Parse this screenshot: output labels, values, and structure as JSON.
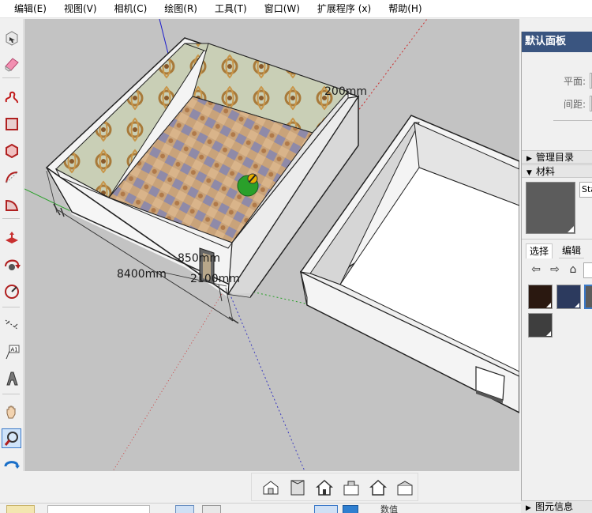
{
  "menu": {
    "items": [
      "编辑(E)",
      "视图(V)",
      "相机(C)",
      "绘图(R)",
      "工具(T)",
      "窗口(W)",
      "扩展程序 (x)",
      "帮助(H)"
    ]
  },
  "viewport": {
    "dimensions": {
      "thickness": "200mm",
      "length": "8400mm",
      "door_width": "850mm",
      "door_height": "2100mm"
    }
  },
  "tray": {
    "title": "默认面板",
    "fields": {
      "plane_label": "平面:",
      "spacing_label": "间距:"
    },
    "sections": {
      "manage_directory": "管理目录",
      "materials": "材料",
      "entity_info": "图元信息"
    },
    "materials": {
      "current_name": "Sta",
      "tabs": {
        "select": "选择",
        "edit": "编辑"
      },
      "swatch_colors": [
        "#2a1810",
        "#2c3a5e",
        "#5c5c5c",
        "#3e3e3e"
      ],
      "current_color": "#5c5c5c"
    }
  },
  "status": {
    "measure_label": "数值"
  },
  "icons": {
    "left_tools": [
      "select-icon",
      "eraser-icon",
      "freehand-icon",
      "rectangle-icon",
      "polygon-icon",
      "arc-icon",
      "pie-icon",
      "push-pull-icon",
      "rotate-icon",
      "offset-icon",
      "tape-measure-icon",
      "text-icon",
      "3d-text-icon",
      "pan-icon",
      "zoom-icon",
      "orbit-icon"
    ],
    "view_tools": [
      "iso-view-icon",
      "top-view-icon",
      "front-view-icon",
      "right-view-icon",
      "back-view-icon",
      "left-view-icon"
    ]
  }
}
